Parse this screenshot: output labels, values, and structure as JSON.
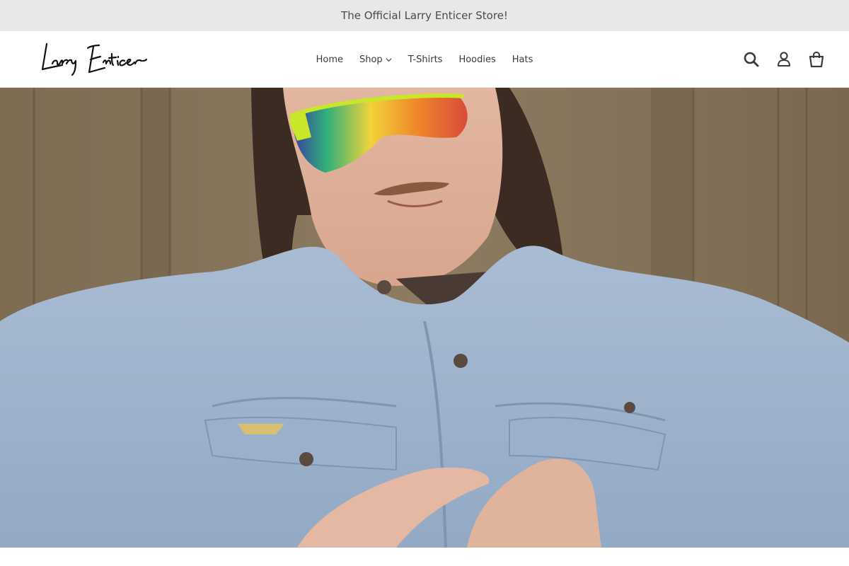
{
  "announcement": {
    "text": "The Official Larry Enticer Store!"
  },
  "header": {
    "logo_text": "Larry Enticer",
    "nav": [
      {
        "label": "Home"
      },
      {
        "label": "Shop",
        "has_dropdown": true
      },
      {
        "label": "T-Shirts"
      },
      {
        "label": "Hoodies"
      },
      {
        "label": "Hats"
      }
    ],
    "icons": [
      "search-icon",
      "account-icon",
      "cart-icon"
    ]
  },
  "colors": {
    "announcement_bg": "#e8e8e8",
    "text": "#3a3a3a",
    "wall": "#8a7a62",
    "denim": "#9fb5cf"
  }
}
